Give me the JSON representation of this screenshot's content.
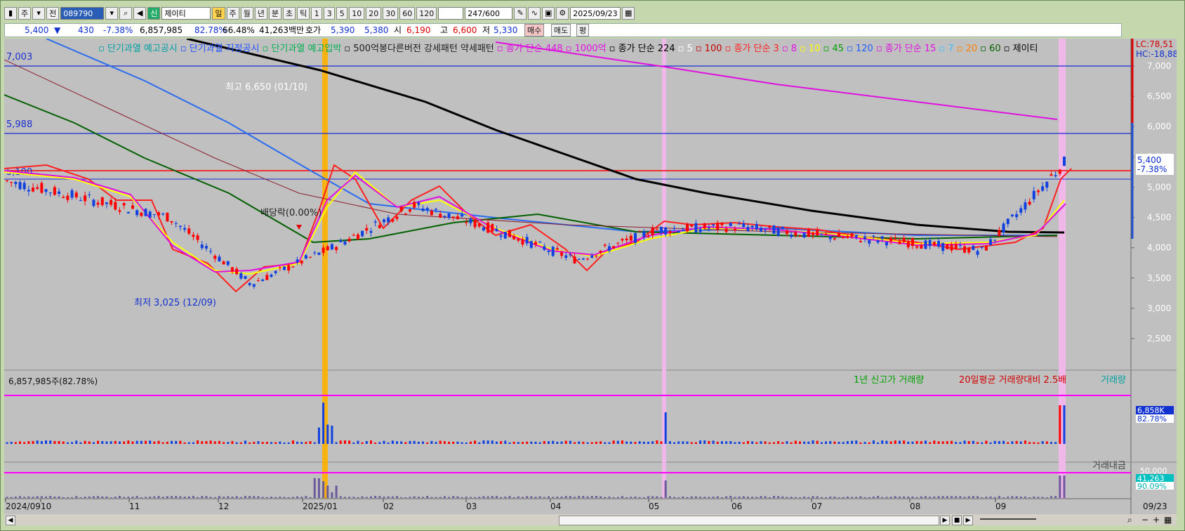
{
  "toolbar": {
    "code": "089790",
    "name": "제이티",
    "period_active": "일",
    "periods": [
      "주",
      "월",
      "년",
      "분",
      "초",
      "틱"
    ],
    "intervals": [
      "1",
      "3",
      "5",
      "10",
      "20",
      "30",
      "60",
      "120"
    ],
    "count": "247",
    "count_total": "/600",
    "date": "2025/09/23",
    "prefix1": "주",
    "prefix2": "전",
    "flag": "신"
  },
  "quote": {
    "price": "5,400",
    "arrow": "▼",
    "change": "430",
    "change_pct": "-7.38%",
    "volume": "6,857,985",
    "vol_ratio": "82.78%",
    "turnover_ratio": "66.48%",
    "amount": "41,263백만",
    "bid_label": "호가",
    "bid1": "5,390",
    "bid2": "5,380",
    "open_label": "시",
    "open": "6,190",
    "high_label": "고",
    "high": "6,600",
    "low_label": "저",
    "low": "5,330",
    "buy": "매수",
    "sell": "매도",
    "eval": "평"
  },
  "legend": {
    "items": [
      {
        "text": "단기과열 예고공시",
        "color": "#00a0a0"
      },
      {
        "text": "단기과열 지정공시",
        "color": "#2050ff"
      },
      {
        "text": "단기과열 예고입박",
        "color": "#00b050"
      },
      {
        "text": "500억봉다른버전 강세패턴 약세패턴",
        "color": "#202020"
      },
      {
        "text": "종가 단순 448",
        "color": "#e010e0"
      },
      {
        "text": "1000억",
        "color": "#e010e0"
      },
      {
        "text": "종가 단순 224",
        "color": "#000000"
      },
      {
        "text": "5",
        "color": "#ffffff"
      },
      {
        "text": "100",
        "color": "#c00000"
      },
      {
        "text": "종가 단순 3",
        "color": "#ff2020"
      },
      {
        "text": "8",
        "color": "#e010e0"
      },
      {
        "text": "10",
        "color": "#ffff00"
      },
      {
        "text": "45",
        "color": "#00a000"
      },
      {
        "text": "120",
        "color": "#2060ff"
      },
      {
        "text": "종가 단순 15",
        "color": "#e010e0"
      },
      {
        "text": "7",
        "color": "#40c0ff"
      },
      {
        "text": "20",
        "color": "#ff8000"
      },
      {
        "text": "60",
        "color": "#006000"
      },
      {
        "text": "제이티",
        "color": "#000000"
      }
    ]
  },
  "price_axis": {
    "ticks": [
      "7,000",
      "6,500",
      "6,000",
      "5,500",
      "5,000",
      "4,500",
      "4,000",
      "3,500",
      "3,000",
      "2,500"
    ],
    "lc": "LC:78,51",
    "hc": "HC:-18,88",
    "current": "5,400",
    "current_pct": "-7.38%"
  },
  "levels": {
    "l1": "7,003",
    "l2": "5,988",
    "l3": "5,100"
  },
  "annotations": {
    "high": "최고 6,650 (01/10)",
    "low": "최저 3,025 (12/09)",
    "dividend": "배당락(0.00%)"
  },
  "volume_panel": {
    "label": "6,857,985주(82.78%)",
    "legend1": "1년 신고가 거래량",
    "legend2": "20일평균 거래량대비 2.5배",
    "legend3": "거래량",
    "value": "6,858K",
    "pct": "82.78%"
  },
  "amount_panel": {
    "legend": "거래대금",
    "top": "50,000",
    "value": "41,263",
    "pct": "90.09%"
  },
  "x_axis": {
    "labels": [
      "2024/09",
      "10",
      "11",
      "12",
      "2025/01",
      "02",
      "03",
      "04",
      "05",
      "06",
      "07",
      "08",
      "09"
    ],
    "end": "09/23"
  },
  "chart_data": {
    "type": "candlestick",
    "title": "제이티",
    "x": [
      "2024/09",
      "10",
      "11",
      "12",
      "2025/01",
      "02",
      "03",
      "04",
      "05",
      "06",
      "07",
      "08",
      "09",
      "09/23"
    ],
    "close": [
      5100,
      4800,
      4500,
      3400,
      4000,
      4700,
      4300,
      3800,
      4300,
      4350,
      4200,
      4100,
      3950,
      5400
    ],
    "ylim": [
      2500,
      7000
    ],
    "reference_levels": [
      7003,
      5988,
      5100
    ],
    "high_mark": 6650,
    "low_mark": 3025
  }
}
